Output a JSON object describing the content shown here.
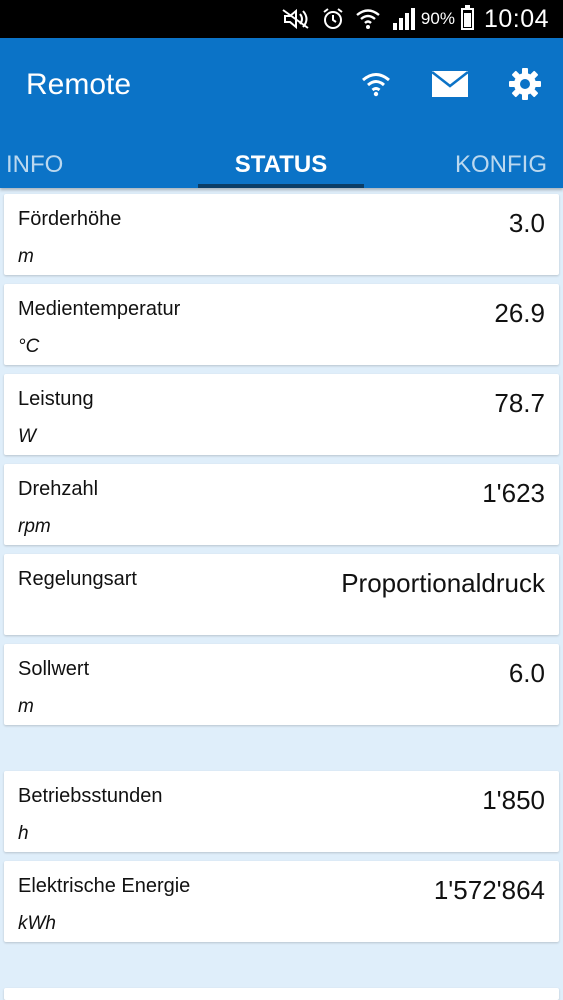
{
  "status_bar": {
    "battery_percent": "90%",
    "battery_level": 0.9,
    "time": "10:04",
    "icons": [
      "mute-icon",
      "alarm-icon",
      "wifi-icon",
      "signal-icon",
      "battery-icon"
    ]
  },
  "header": {
    "title": "Remote",
    "actions": [
      "wifi-icon",
      "mail-icon",
      "gear-icon"
    ],
    "color": "#0b73c7"
  },
  "tabs": [
    {
      "label": "INFO",
      "active": false
    },
    {
      "label": "STATUS",
      "active": true
    },
    {
      "label": "KONFIG",
      "active": false
    }
  ],
  "status": {
    "group1": [
      {
        "label": "Förderhöhe",
        "unit": "m",
        "value": "3.0"
      },
      {
        "label": "Medientemperatur",
        "unit": "°C",
        "value": "26.9"
      },
      {
        "label": "Leistung",
        "unit": "W",
        "value": "78.7"
      },
      {
        "label": "Drehzahl",
        "unit": "rpm",
        "value": "1'623"
      },
      {
        "label": "Regelungsart",
        "unit": "",
        "value": "Proportionaldruck"
      },
      {
        "label": "Sollwert",
        "unit": "m",
        "value": "6.0"
      }
    ],
    "group2": [
      {
        "label": "Betriebsstunden",
        "unit": "h",
        "value": "1'850"
      },
      {
        "label": "Elektrische Energie",
        "unit": "kWh",
        "value": "1'572'864"
      }
    ]
  }
}
